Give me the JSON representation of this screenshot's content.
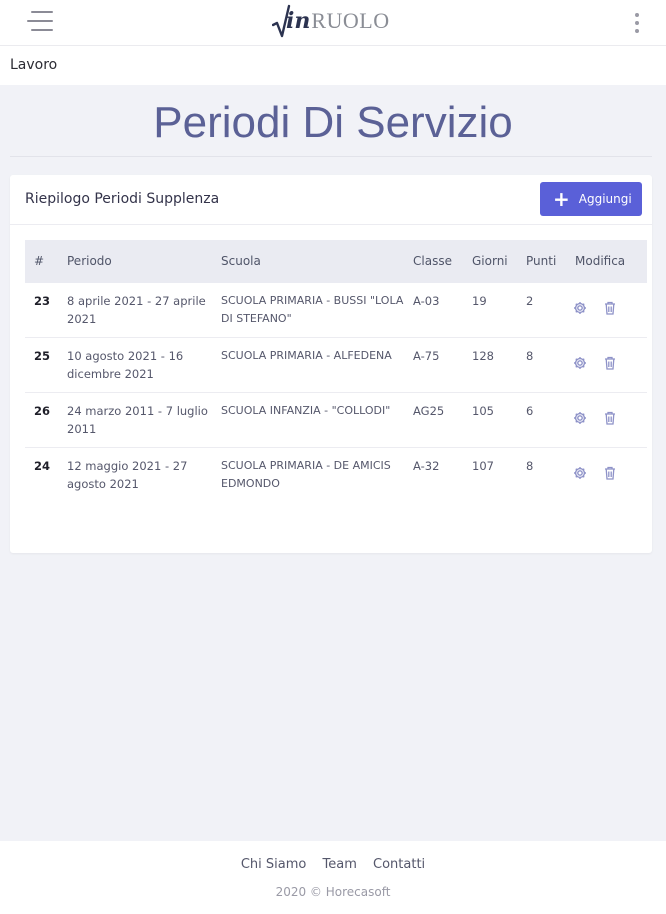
{
  "app": {
    "logo_symbol": "√",
    "logo_in": "in",
    "logo_text": "RUOLO"
  },
  "section": {
    "label": "Lavoro"
  },
  "page": {
    "title": "Periodi Di Servizio"
  },
  "card": {
    "title": "Riepilogo Periodi Supplenza",
    "add_label": "Aggiungi",
    "add_color": "#5a60d8"
  },
  "table": {
    "headers": [
      "#",
      "Periodo",
      "Scuola",
      "Classe",
      "Giorni",
      "Punti",
      "Modifica"
    ],
    "rows": [
      {
        "id": "23",
        "period": "8 aprile 2021 - 27 aprile 2021",
        "school": "SCUOLA PRIMARIA - BUSSI \"LOLA DI STEFANO\"",
        "class": "A-03",
        "days": "19",
        "points": "2"
      },
      {
        "id": "25",
        "period": "10 agosto 2021 - 16 dicembre 2021",
        "school": "SCUOLA PRIMARIA - ALFEDENA",
        "class": "A-75",
        "days": "128",
        "points": "8"
      },
      {
        "id": "26",
        "period": "24 marzo 2011 - 7 luglio 2011",
        "school": "SCUOLA INFANZIA - \"COLLODI\"",
        "class": "AG25",
        "days": "105",
        "points": "6"
      },
      {
        "id": "24",
        "period": "12 maggio 2021 - 27 agosto 2021",
        "school": "SCUOLA PRIMARIA - DE AMICIS EDMONDO",
        "class": "A-32",
        "days": "107",
        "points": "8"
      }
    ],
    "row_icons": [
      "gear-icon",
      "trash-icon"
    ]
  },
  "footer": {
    "links": [
      "Chi Siamo",
      "Team",
      "Contatti"
    ],
    "copyright": "2020 © Horecasoft"
  },
  "colors": {
    "accent": "#5a60d8",
    "title": "#5b6196",
    "icon": "#8e92c8"
  }
}
